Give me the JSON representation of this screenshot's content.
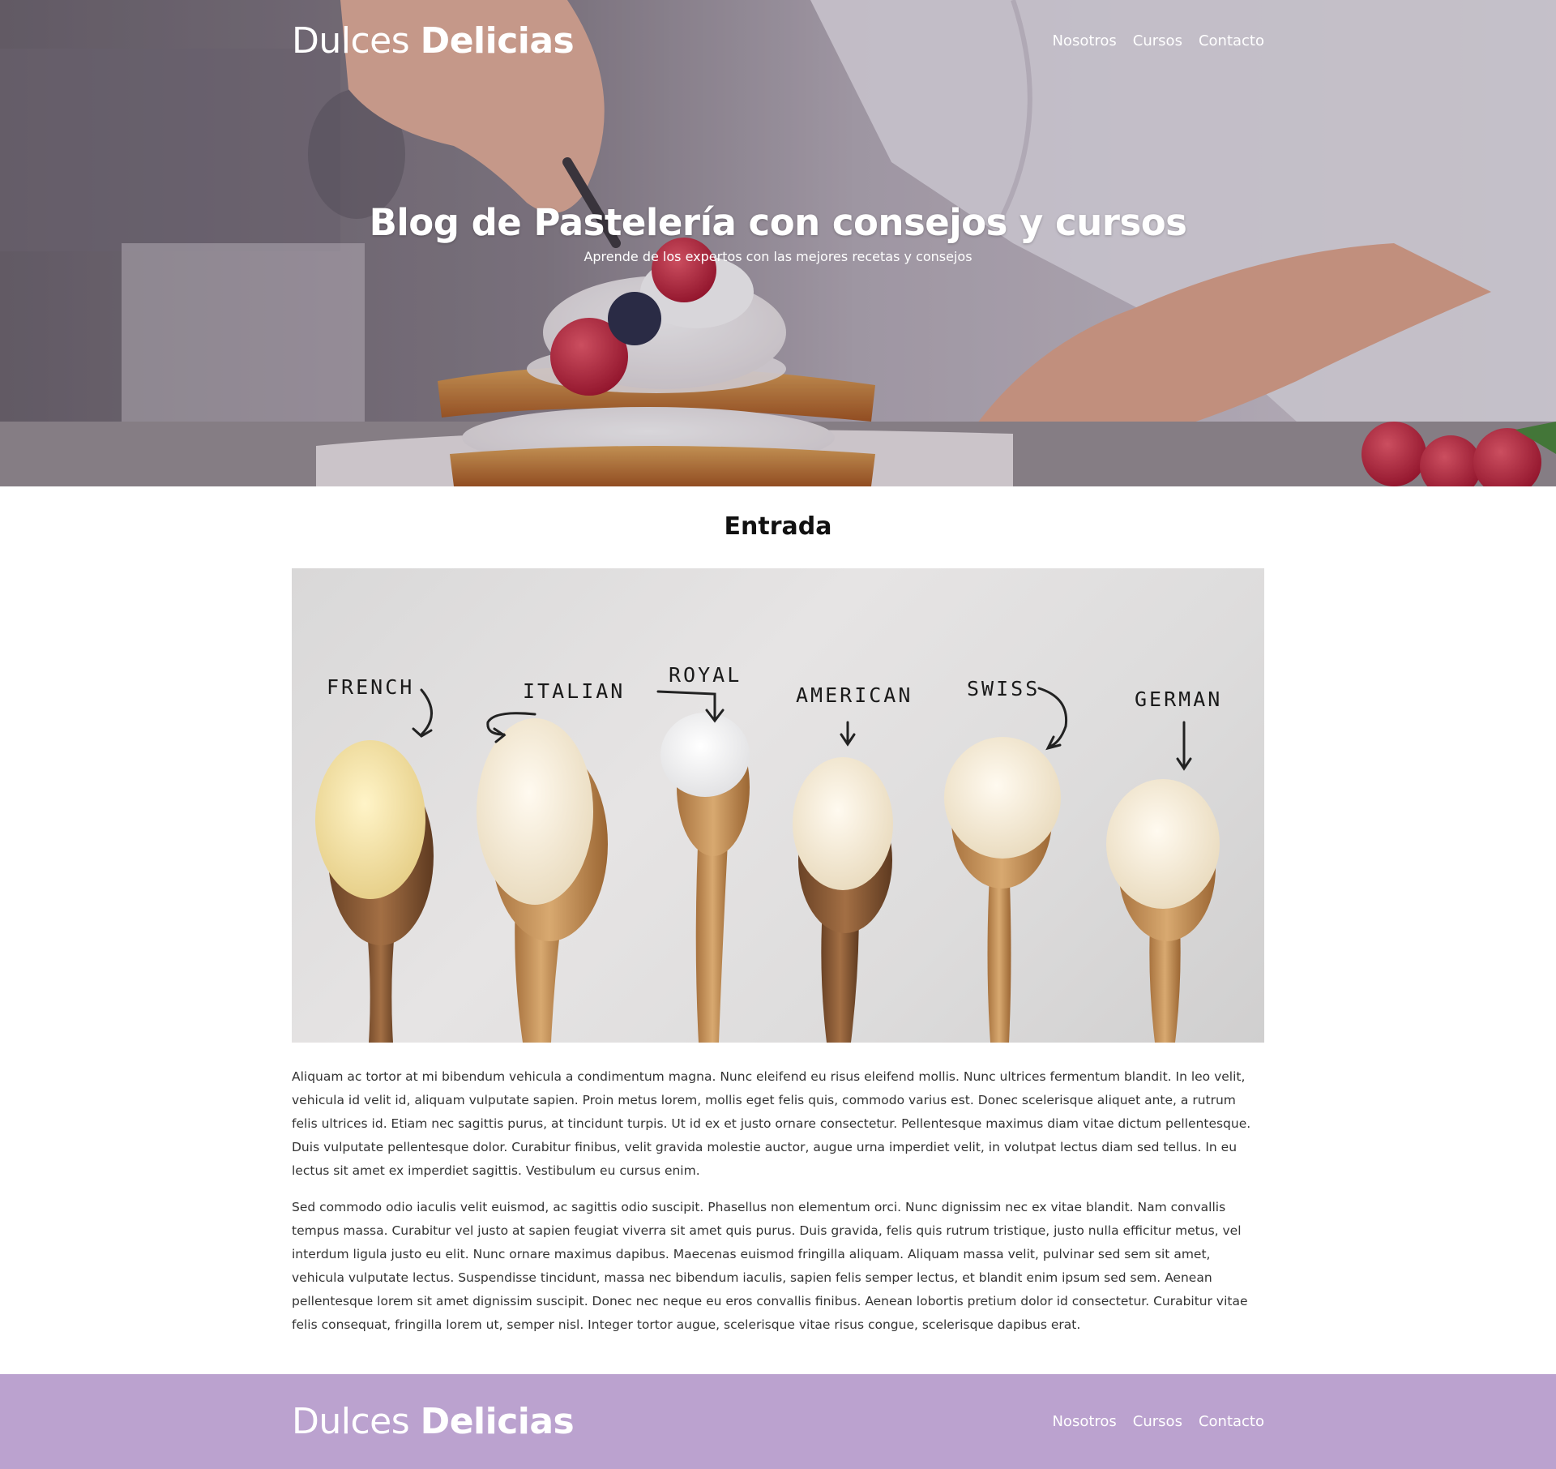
{
  "header": {
    "logo_light": "Dulces ",
    "logo_bold": "Delicias",
    "nav": [
      "Nosotros",
      "Cursos",
      "Contacto"
    ]
  },
  "hero": {
    "title": "Blog de Pastelería con consejos y cursos",
    "subtitle": "Aprende de los expertos con las mejores recetas y consejos"
  },
  "main": {
    "section_title": "Entrada",
    "image_labels": [
      "FRENCH",
      "ITALIAN",
      "ROYAL",
      "AMERICAN",
      "SWISS",
      "GERMAN"
    ],
    "paragraphs": [
      "Aliquam ac tortor at mi bibendum vehicula a condimentum magna. Nunc eleifend eu risus eleifend mollis. Nunc ultrices fermentum blandit. In leo velit, vehicula id velit id, aliquam vulputate sapien. Proin metus lorem, mollis eget felis quis, commodo varius est. Donec scelerisque aliquet ante, a rutrum felis ultrices id. Etiam nec sagittis purus, at tincidunt turpis. Ut id ex et justo ornare consectetur. Pellentesque maximus diam vitae dictum pellentesque. Duis vulputate pellentesque dolor. Curabitur finibus, velit gravida molestie auctor, augue urna imperdiet velit, in volutpat lectus diam sed tellus. In eu lectus sit amet ex imperdiet sagittis. Vestibulum eu cursus enim.",
      "Sed commodo odio iaculis velit euismod, ac sagittis odio suscipit. Phasellus non elementum orci. Nunc dignissim nec ex vitae blandit. Nam convallis tempus massa. Curabitur vel justo at sapien feugiat viverra sit amet quis purus. Duis gravida, felis quis rutrum tristique, justo nulla efficitur metus, vel interdum ligula justo eu elit. Nunc ornare maximus dapibus. Maecenas euismod fringilla aliquam. Aliquam massa velit, pulvinar sed sem sit amet, vehicula vulputate lectus. Suspendisse tincidunt, massa nec bibendum iaculis, sapien felis semper lectus, et blandit enim ipsum sed sem. Aenean pellentesque lorem sit amet dignissim suscipit. Donec nec neque eu eros convallis finibus. Aenean lobortis pretium dolor id consectetur. Curabitur vitae felis consequat, fringilla lorem ut, semper nisl. Integer tortor augue, scelerisque vitae risus congue, scelerisque dapibus erat."
    ]
  },
  "footer": {
    "logo_light": "Dulces ",
    "logo_bold": "Delicias",
    "nav": [
      "Nosotros",
      "Cursos",
      "Contacto"
    ]
  },
  "colors": {
    "footer_bg": "#bba2cf",
    "text": "#333333",
    "white": "#ffffff"
  }
}
